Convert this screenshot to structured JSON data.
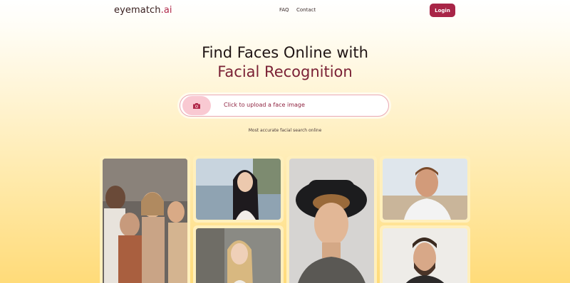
{
  "nav": {
    "logo_main": "eyematch",
    "logo_suffix": ".ai",
    "links": [
      "FAQ",
      "Contact"
    ],
    "login_label": "Login"
  },
  "hero": {
    "title_line1": "Find Faces Online with",
    "title_line2": "Facial Recognition"
  },
  "upload": {
    "label": "Click to upload a face image",
    "icon": "camera-icon"
  },
  "tagline": "Most accurate facial search online",
  "colors": {
    "brand": "#a82547",
    "accent_text": "#7a2135",
    "upload_icon_bg": "#f9c9d2",
    "background_top": "#ffffff",
    "background_bottom": "#ffdb79"
  },
  "gallery": [
    {
      "name": "group-friends-photo"
    },
    {
      "name": "woman-seaside-photo"
    },
    {
      "name": "curly-hat-man-photo"
    },
    {
      "name": "smiling-man-beach-photo"
    },
    {
      "name": "blonde-woman-photo"
    },
    {
      "name": "bearded-man-photo"
    }
  ]
}
